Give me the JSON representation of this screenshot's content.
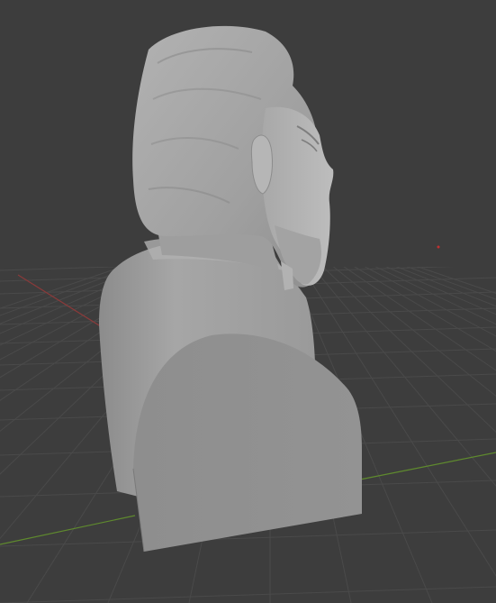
{
  "viewport": {
    "background_color": "#3d3d3d",
    "grid_color": "#4a4a4a",
    "x_axis_color": "#8a3a3a",
    "y_axis_color": "#5f8a2e",
    "object_color": "#9a9a9a",
    "object_highlight_color": "#c4c4c4",
    "object_shadow_color": "#6e6e6e",
    "origin_marker_color": "#c03030",
    "object_icon": "sculpted-bust-icon"
  }
}
